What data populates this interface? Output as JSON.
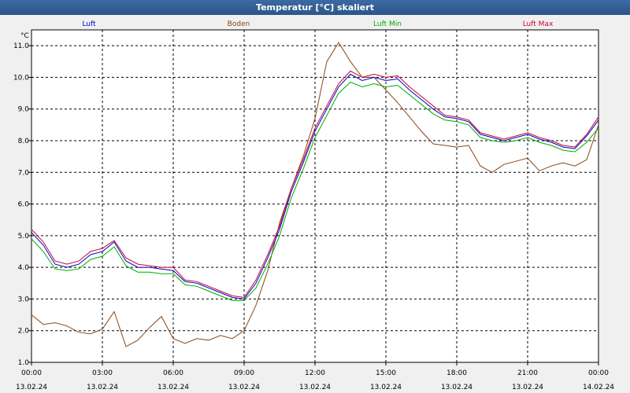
{
  "window": {
    "title": "Temperatur [°C] skaliert"
  },
  "chart_data": {
    "type": "line",
    "unit": "°C",
    "ylim": [
      1.0,
      11.5
    ],
    "y_ticks": [
      "1.0",
      "2.0",
      "3.0",
      "4.0",
      "5.0",
      "6.0",
      "7.0",
      "8.0",
      "9.0",
      "10.0",
      "11.0"
    ],
    "x_ticks": [
      {
        "time": "00:00",
        "date": "13.02.24"
      },
      {
        "time": "03:00",
        "date": "13.02.24"
      },
      {
        "time": "06:00",
        "date": "13.02.24"
      },
      {
        "time": "09:00",
        "date": "13.02.24"
      },
      {
        "time": "12:00",
        "date": "13.02.24"
      },
      {
        "time": "15:00",
        "date": "13.02.24"
      },
      {
        "time": "18:00",
        "date": "13.02.24"
      },
      {
        "time": "21:00",
        "date": "13.02.24"
      },
      {
        "time": "00:00",
        "date": "14.02.24"
      }
    ],
    "x_hours": [
      0,
      0.5,
      1,
      1.5,
      2,
      2.5,
      3,
      3.5,
      4,
      4.5,
      5,
      5.5,
      6,
      6.5,
      7,
      7.5,
      8,
      8.5,
      9,
      9.5,
      10,
      10.5,
      11,
      11.5,
      12,
      12.5,
      13,
      13.5,
      14,
      14.5,
      15,
      15.5,
      16,
      16.5,
      17,
      17.5,
      18,
      18.5,
      19,
      19.5,
      20,
      20.5,
      21,
      21.5,
      22,
      22.5,
      23,
      23.5,
      24
    ],
    "grid": true,
    "legend_position": "top",
    "series": [
      {
        "name": "Luft",
        "color": "#0000cc",
        "values": [
          5.1,
          4.7,
          4.1,
          4.0,
          4.1,
          4.4,
          4.5,
          4.8,
          4.2,
          4.0,
          4.0,
          3.95,
          3.9,
          3.55,
          3.5,
          3.35,
          3.2,
          3.05,
          3.0,
          3.5,
          4.3,
          5.2,
          6.4,
          7.3,
          8.3,
          9.0,
          9.7,
          10.1,
          9.9,
          10.0,
          9.9,
          9.95,
          9.6,
          9.3,
          9.0,
          8.75,
          8.7,
          8.6,
          8.2,
          8.1,
          8.0,
          8.1,
          8.2,
          8.05,
          7.95,
          7.8,
          7.75,
          8.15,
          8.65
        ]
      },
      {
        "name": "Boden",
        "color": "#8b4513",
        "values": [
          2.5,
          2.2,
          2.25,
          2.15,
          1.95,
          1.9,
          2.05,
          2.6,
          1.5,
          1.7,
          2.1,
          2.45,
          1.75,
          1.6,
          1.75,
          1.7,
          1.85,
          1.75,
          2.0,
          2.8,
          3.9,
          5.4,
          6.5,
          7.5,
          8.7,
          10.5,
          11.1,
          10.5,
          10.0,
          10.0,
          9.6,
          9.2,
          8.75,
          8.3,
          7.9,
          7.85,
          7.8,
          7.85,
          7.2,
          7.0,
          7.25,
          7.35,
          7.45,
          7.05,
          7.2,
          7.3,
          7.2,
          7.4,
          8.5
        ]
      },
      {
        "name": "Luft Min",
        "color": "#00aa00",
        "values": [
          4.9,
          4.5,
          3.95,
          3.9,
          3.95,
          4.25,
          4.35,
          4.65,
          4.05,
          3.85,
          3.85,
          3.8,
          3.8,
          3.45,
          3.4,
          3.25,
          3.1,
          2.95,
          2.95,
          3.35,
          4.1,
          5.0,
          6.2,
          7.1,
          8.1,
          8.8,
          9.5,
          9.85,
          9.7,
          9.8,
          9.7,
          9.75,
          9.45,
          9.15,
          8.85,
          8.65,
          8.6,
          8.5,
          8.1,
          8.0,
          7.95,
          8.0,
          8.1,
          7.95,
          7.85,
          7.7,
          7.65,
          7.95,
          8.4
        ]
      },
      {
        "name": "Luft Max",
        "color": "#cc0033",
        "values": [
          5.2,
          4.8,
          4.2,
          4.1,
          4.2,
          4.5,
          4.6,
          4.85,
          4.3,
          4.1,
          4.05,
          4.0,
          4.0,
          3.6,
          3.55,
          3.4,
          3.25,
          3.1,
          3.05,
          3.6,
          4.4,
          5.3,
          6.5,
          7.4,
          8.4,
          9.1,
          9.8,
          10.2,
          10.0,
          10.1,
          10.0,
          10.05,
          9.7,
          9.4,
          9.1,
          8.8,
          8.75,
          8.65,
          8.25,
          8.15,
          8.05,
          8.15,
          8.25,
          8.1,
          8.0,
          7.85,
          7.8,
          8.2,
          8.75
        ]
      }
    ]
  }
}
